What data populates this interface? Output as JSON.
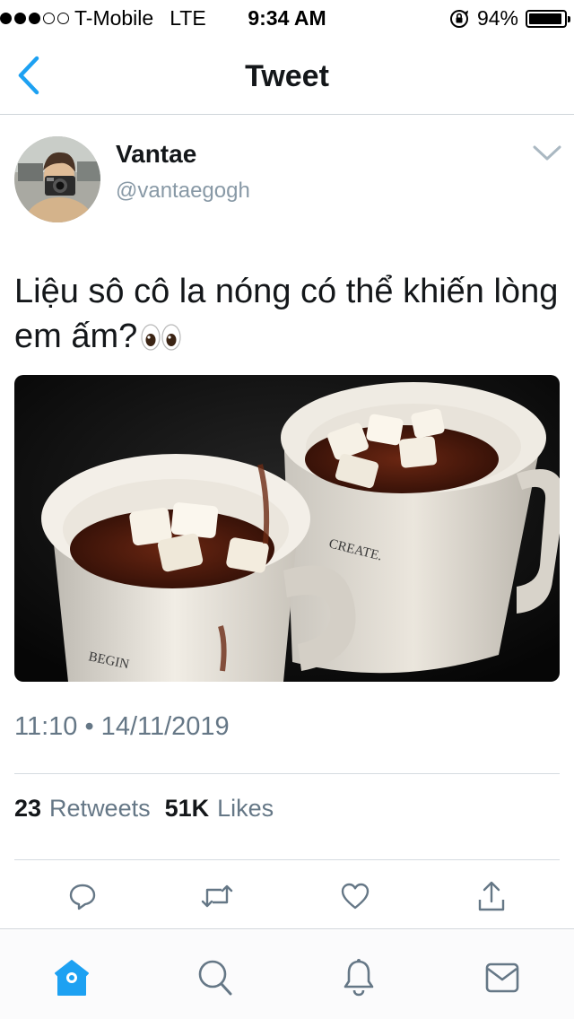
{
  "status_bar": {
    "carrier": "T-Mobile",
    "network": "LTE",
    "time": "9:34 AM",
    "battery_percent": "94%",
    "battery_level": 0.94,
    "signal_bars": 3,
    "icons": [
      "signal-icon",
      "orientation-lock-icon",
      "battery-icon"
    ]
  },
  "nav": {
    "title": "Tweet",
    "back_icon": "chevron-left-icon",
    "accent_color": "#1da1f2"
  },
  "tweet": {
    "author": {
      "display_name": "Vantae",
      "username": "@vantaegogh"
    },
    "text": "Liệu sô cô la nóng có thể khiến lòng em ấm?",
    "text_emoji": "eyes-emoji",
    "media": {
      "description_icon": "hot-chocolate-photo",
      "mug_left_text": "BEGIN",
      "mug_right_text": "CREATE."
    },
    "timestamp": "11:10 • 14/11/2019",
    "stats": {
      "retweets_count": "23",
      "retweets_label": "Retweets",
      "likes_count": "51K",
      "likes_label": "Likes"
    }
  },
  "actions": [
    "reply-icon",
    "retweet-icon",
    "like-icon",
    "share-icon"
  ],
  "tab_bar": {
    "items": [
      "home-icon",
      "search-icon",
      "notifications-icon",
      "messages-icon"
    ],
    "active": "home-icon",
    "active_color": "#1da1f2",
    "inactive_color": "#657786"
  }
}
